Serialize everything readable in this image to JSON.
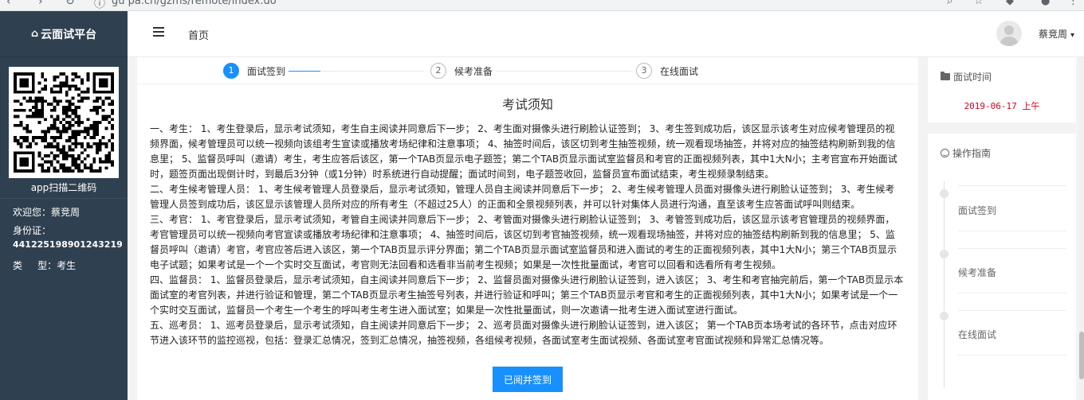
{
  "browser": {
    "url": "gu pa.cn/gzms/remote/index.do"
  },
  "sidebar": {
    "brand": "云面试平台",
    "qr_caption": "app扫描二维码",
    "welcome": "欢迎您：蔡竞周",
    "id_label": "身份证：",
    "id_number": "441225198901243219",
    "type_label": "类     型：考生"
  },
  "header": {
    "home_label": "首页",
    "username": "蔡竞周",
    "caret": "▾"
  },
  "steps": [
    {
      "num": "1",
      "label": "面试签到"
    },
    {
      "num": "2",
      "label": "候考准备"
    },
    {
      "num": "3",
      "label": "在线面试"
    }
  ],
  "document": {
    "title": "考试须知",
    "paragraphs": [
      "一、考生： 1、考生登录后，显示考试须知，考生自主阅读并同意后下一步； 2、考生面对摄像头进行刷脸认证签到； 3、考生签到成功后，该区显示该考生对应候考管理员的视频界面，候考管理员可以统一视频向该组考生宣读或播放考场纪律和注意事项； 4、抽签时间后，该区切到考生抽签视频，统一观看现场抽签，并将对应的抽签结构刷新到我的信息里； 5、监督员呼叫（邀请）考生，考生应答后该区，第一个TAB页显示电子题签；第二个TAB页显示面试室监督员和考官的正面视频列表，其中1大N小；主考官宣布开始面试时，题签页面出现倒计时，到最后3分钟（或1分钟）时系统进行自动提醒；面试时间到，电子题签收回，监督员宣布面试结束，考生视频录制结束。",
      "二、考生候考管理人员： 1、考生候考管理人员登录后，显示考试须知，管理人员自主阅读并同意后下一步； 2、考生候考管理人员面对摄像头进行刷脸认证签到； 3、考生候考管理人员签到成功后，该区显示该管理人员所对应的所有考生（不超过25人）的正面和全景视频列表，并可以针对集体人员进行沟通，直至该考生应答面试呼叫则结束。",
      "三、考官： 1、考官登录后，显示考试须知，考管自主阅读并同意后下一步； 2、考管面对摄像头进行刷脸认证签到； 3、考管签到成功后，该区显示该考官管理员的视频界面，考官管理员可以统一视频向考官宣读或播放考场纪律和注意事项； 4、抽签时间后，该区切到考官抽签视频，统一观看现场抽签，并将对应的抽签结构刷新到我的信息里； 5、监督员呼叫（邀请）考官，考官应答后进入该区，第一个TAB页显示评分界面；第二个TAB页显示面试室监督员和进入面试的考生的正面视频列表，其中1大N小；第三个TAB页显示电子试题；如果考试是一个一个实时交互面试，考官则无法回看和选看非当前考生视频；如果是一次性批量面试，考官可以回看和选看所有考生视频。",
      "四、监督员： 1、监督员登录后，显示考试须知，自主阅读并同意后下一步； 2、监督员面对摄像头进行刷脸认证签到，进入该区； 3、考生和考官抽完前后，第一个TAB页显示本面试室的考官列表，并进行验证和管理，第二个TAB页显示考生抽签号列表，并进行验证和呼叫；第三个TAB页显示考官和考生的正面视频列表，其中1大N小；如果考试是一个一个实时交互面试，监督员一个考生一个考生的呼叫考生考生进入面试室；如果是一次性批量面试，则一次邀请一批考生进入面试室进行面试。",
      "五、巡考员： 1、巡考员登录后，显示考试须知，自主阅读并同意后下一步； 2、巡考员面对摄像头进行刷脸认证签到，进入该区； 第一个TAB页本场考试的各环节，点击对应环节进入该环节的监控巡视，包括：登录汇总情况，签到汇总情况，抽签视频，各组候考视频，各面试室考生面试视频、各面试室考官面试视频和异常汇总情况等。"
    ],
    "button_label": "已阅并签到"
  },
  "right_panel": {
    "time_title": "面试时间",
    "time_value": "2019-06-17 上午",
    "guide_title": "操作指南",
    "guide_items": [
      "面试签到",
      "候考准备",
      "在线面试"
    ]
  }
}
